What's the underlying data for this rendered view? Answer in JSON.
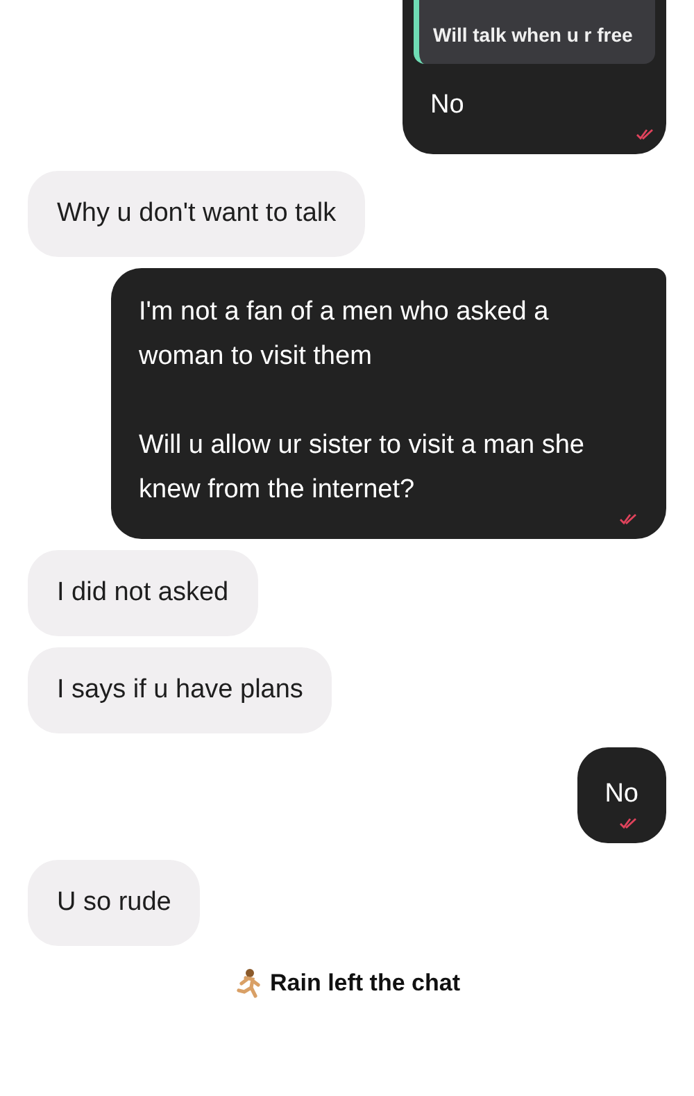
{
  "messages": [
    {
      "kind": "out",
      "quote": "Will talk when u r free",
      "paragraphs": [
        "No"
      ],
      "read": true
    },
    {
      "kind": "in",
      "paragraphs": [
        "Why u don't want to talk"
      ]
    },
    {
      "kind": "out",
      "paragraphs": [
        "I'm not a fan of a men who asked a woman to visit them",
        "Will u allow ur sister to visit a man she knew from the internet?"
      ],
      "read": true
    },
    {
      "kind": "in",
      "paragraphs": [
        "I did not asked"
      ]
    },
    {
      "kind": "in",
      "paragraphs": [
        "I says if u have plans"
      ]
    },
    {
      "kind": "out",
      "paragraphs": [
        "No"
      ],
      "read": true
    },
    {
      "kind": "in",
      "paragraphs": [
        "U so rude"
      ]
    },
    {
      "kind": "system",
      "text": "Rain left the chat"
    }
  ]
}
